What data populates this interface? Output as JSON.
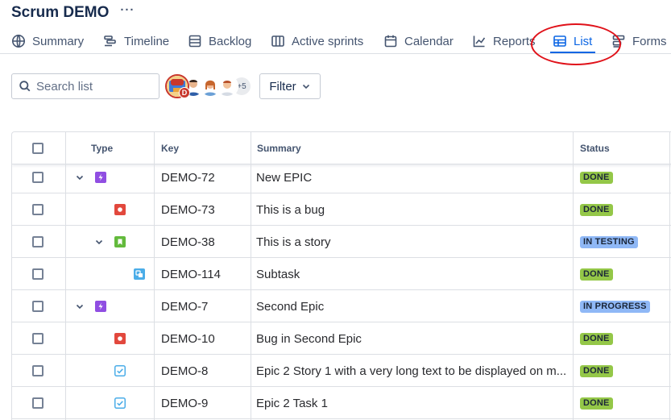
{
  "project": {
    "title": "Scrum DEMO",
    "more": "···"
  },
  "tabs": [
    {
      "label": "Summary",
      "icon": "globe-icon"
    },
    {
      "label": "Timeline",
      "icon": "timeline-icon"
    },
    {
      "label": "Backlog",
      "icon": "backlog-icon"
    },
    {
      "label": "Active sprints",
      "icon": "board-icon"
    },
    {
      "label": "Calendar",
      "icon": "calendar-icon"
    },
    {
      "label": "Reports",
      "icon": "chart-line-icon"
    },
    {
      "label": "List",
      "icon": "list-table-icon",
      "active": true
    },
    {
      "label": "Forms",
      "icon": "forms-icon"
    }
  ],
  "toolbar": {
    "search_placeholder": "Search list",
    "avatar_overflow": "+5",
    "avatar_badge": "D",
    "filter_label": "Filter"
  },
  "table": {
    "columns": [
      "Type",
      "Key",
      "Summary",
      "Status"
    ],
    "rows": [
      {
        "type": "epic",
        "key": "DEMO-72",
        "summary": "New EPIC",
        "status": "DONE",
        "level": 0,
        "expander": true
      },
      {
        "type": "bug",
        "key": "DEMO-73",
        "summary": "This is a bug",
        "status": "DONE",
        "level": 1,
        "expander": false
      },
      {
        "type": "story",
        "key": "DEMO-38",
        "summary": "This is a story",
        "status": "IN TESTING",
        "level": 1,
        "expander": true
      },
      {
        "type": "subtask",
        "key": "DEMO-114",
        "summary": "Subtask",
        "status": "DONE",
        "level": 2,
        "expander": false
      },
      {
        "type": "epic",
        "key": "DEMO-7",
        "summary": "Second Epic",
        "status": "IN PROGRESS",
        "level": 0,
        "expander": true
      },
      {
        "type": "bug",
        "key": "DEMO-10",
        "summary": "Bug in Second Epic",
        "status": "DONE",
        "level": 1,
        "expander": false
      },
      {
        "type": "task",
        "key": "DEMO-8",
        "summary": "Epic 2 Story 1 with a very long text to be displayed on m...",
        "status": "DONE",
        "level": 1,
        "expander": false
      },
      {
        "type": "task",
        "key": "DEMO-9",
        "summary": "Epic 2 Task 1",
        "status": "DONE",
        "level": 1,
        "expander": false
      }
    ]
  },
  "colors": {
    "accent": "#0c66e4",
    "epic": "#904ee2",
    "bug": "#e2483d",
    "story": "#63ba3c",
    "subtask": "#4bade8",
    "task": "#4bade8",
    "done": "#94c748",
    "in_progress": "#8fb8f6",
    "annotation": "#e0121a"
  }
}
